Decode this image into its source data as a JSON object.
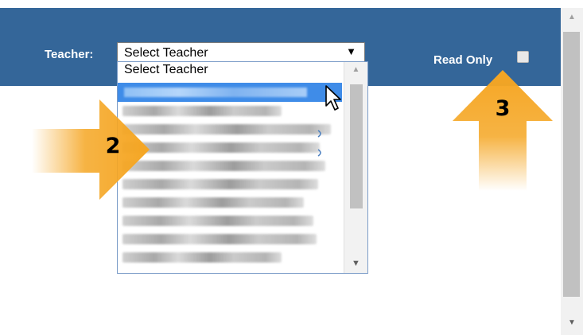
{
  "header": {
    "teacher_label": "Teacher:",
    "select_value": "Select Teacher",
    "read_only_label": "Read Only",
    "read_only_checked": false,
    "background_color": "#346699"
  },
  "dropdown": {
    "options_visible": [
      {
        "label": "Select Teacher",
        "state": "default",
        "blurred": false
      },
      {
        "label": "",
        "state": "highlighted",
        "blurred": true
      },
      {
        "label": "",
        "state": "default",
        "blurred": true
      },
      {
        "label": "",
        "state": "default",
        "blurred": true
      },
      {
        "label": "",
        "state": "default",
        "blurred": true
      },
      {
        "label": "",
        "state": "default",
        "blurred": true
      },
      {
        "label": "",
        "state": "default",
        "blurred": true
      },
      {
        "label": "",
        "state": "default",
        "blurred": true
      },
      {
        "label": "",
        "state": "default",
        "blurred": true
      },
      {
        "label": "",
        "state": "default",
        "blurred": true
      },
      {
        "label": "",
        "state": "default",
        "blurred": true
      }
    ],
    "highlight_color": "#3f8ce8"
  },
  "callouts": [
    {
      "number": "2",
      "direction": "right",
      "color": "#f5a623"
    },
    {
      "number": "3",
      "direction": "up",
      "color": "#f5a623"
    }
  ],
  "icons": {
    "select_arrow": "dropdown-arrow-icon",
    "cursor": "mouse-pointer-icon",
    "scroll_up": "scroll-up-icon",
    "scroll_down": "scroll-down-icon"
  },
  "glyphs": {
    "down_triangle": "▼",
    "up_small": "▲",
    "down_small": "▼"
  }
}
